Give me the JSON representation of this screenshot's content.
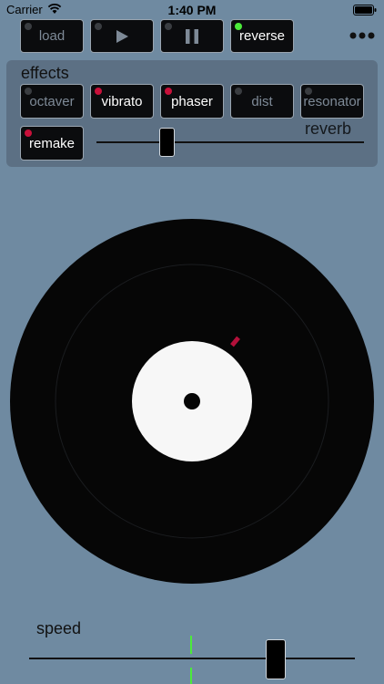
{
  "status": {
    "carrier": "Carrier",
    "time": "1:40 PM"
  },
  "toolbar": {
    "load_label": "load",
    "play_icon": "play-icon",
    "pause_icon": "pause-icon",
    "reverse_label": "reverse",
    "reverse_active": true,
    "more_icon": "more-icon"
  },
  "effects": {
    "title": "effects",
    "items": [
      {
        "label": "octaver",
        "active": false
      },
      {
        "label": "vibrato",
        "active": true
      },
      {
        "label": "phaser",
        "active": true
      },
      {
        "label": "dist",
        "active": false
      },
      {
        "label": "resonator",
        "active": false
      }
    ],
    "remake_label": "remake",
    "remake_active": true,
    "reverb_label": "reverb",
    "reverb_level": 0.25
  },
  "speed": {
    "label": "speed",
    "level": 0.75
  },
  "colors": {
    "background": "#6f8aa1",
    "panel": "#5c7084",
    "led_on": "#c8103a",
    "led_green": "#4bea3a",
    "led_off": "#3a3d41"
  }
}
